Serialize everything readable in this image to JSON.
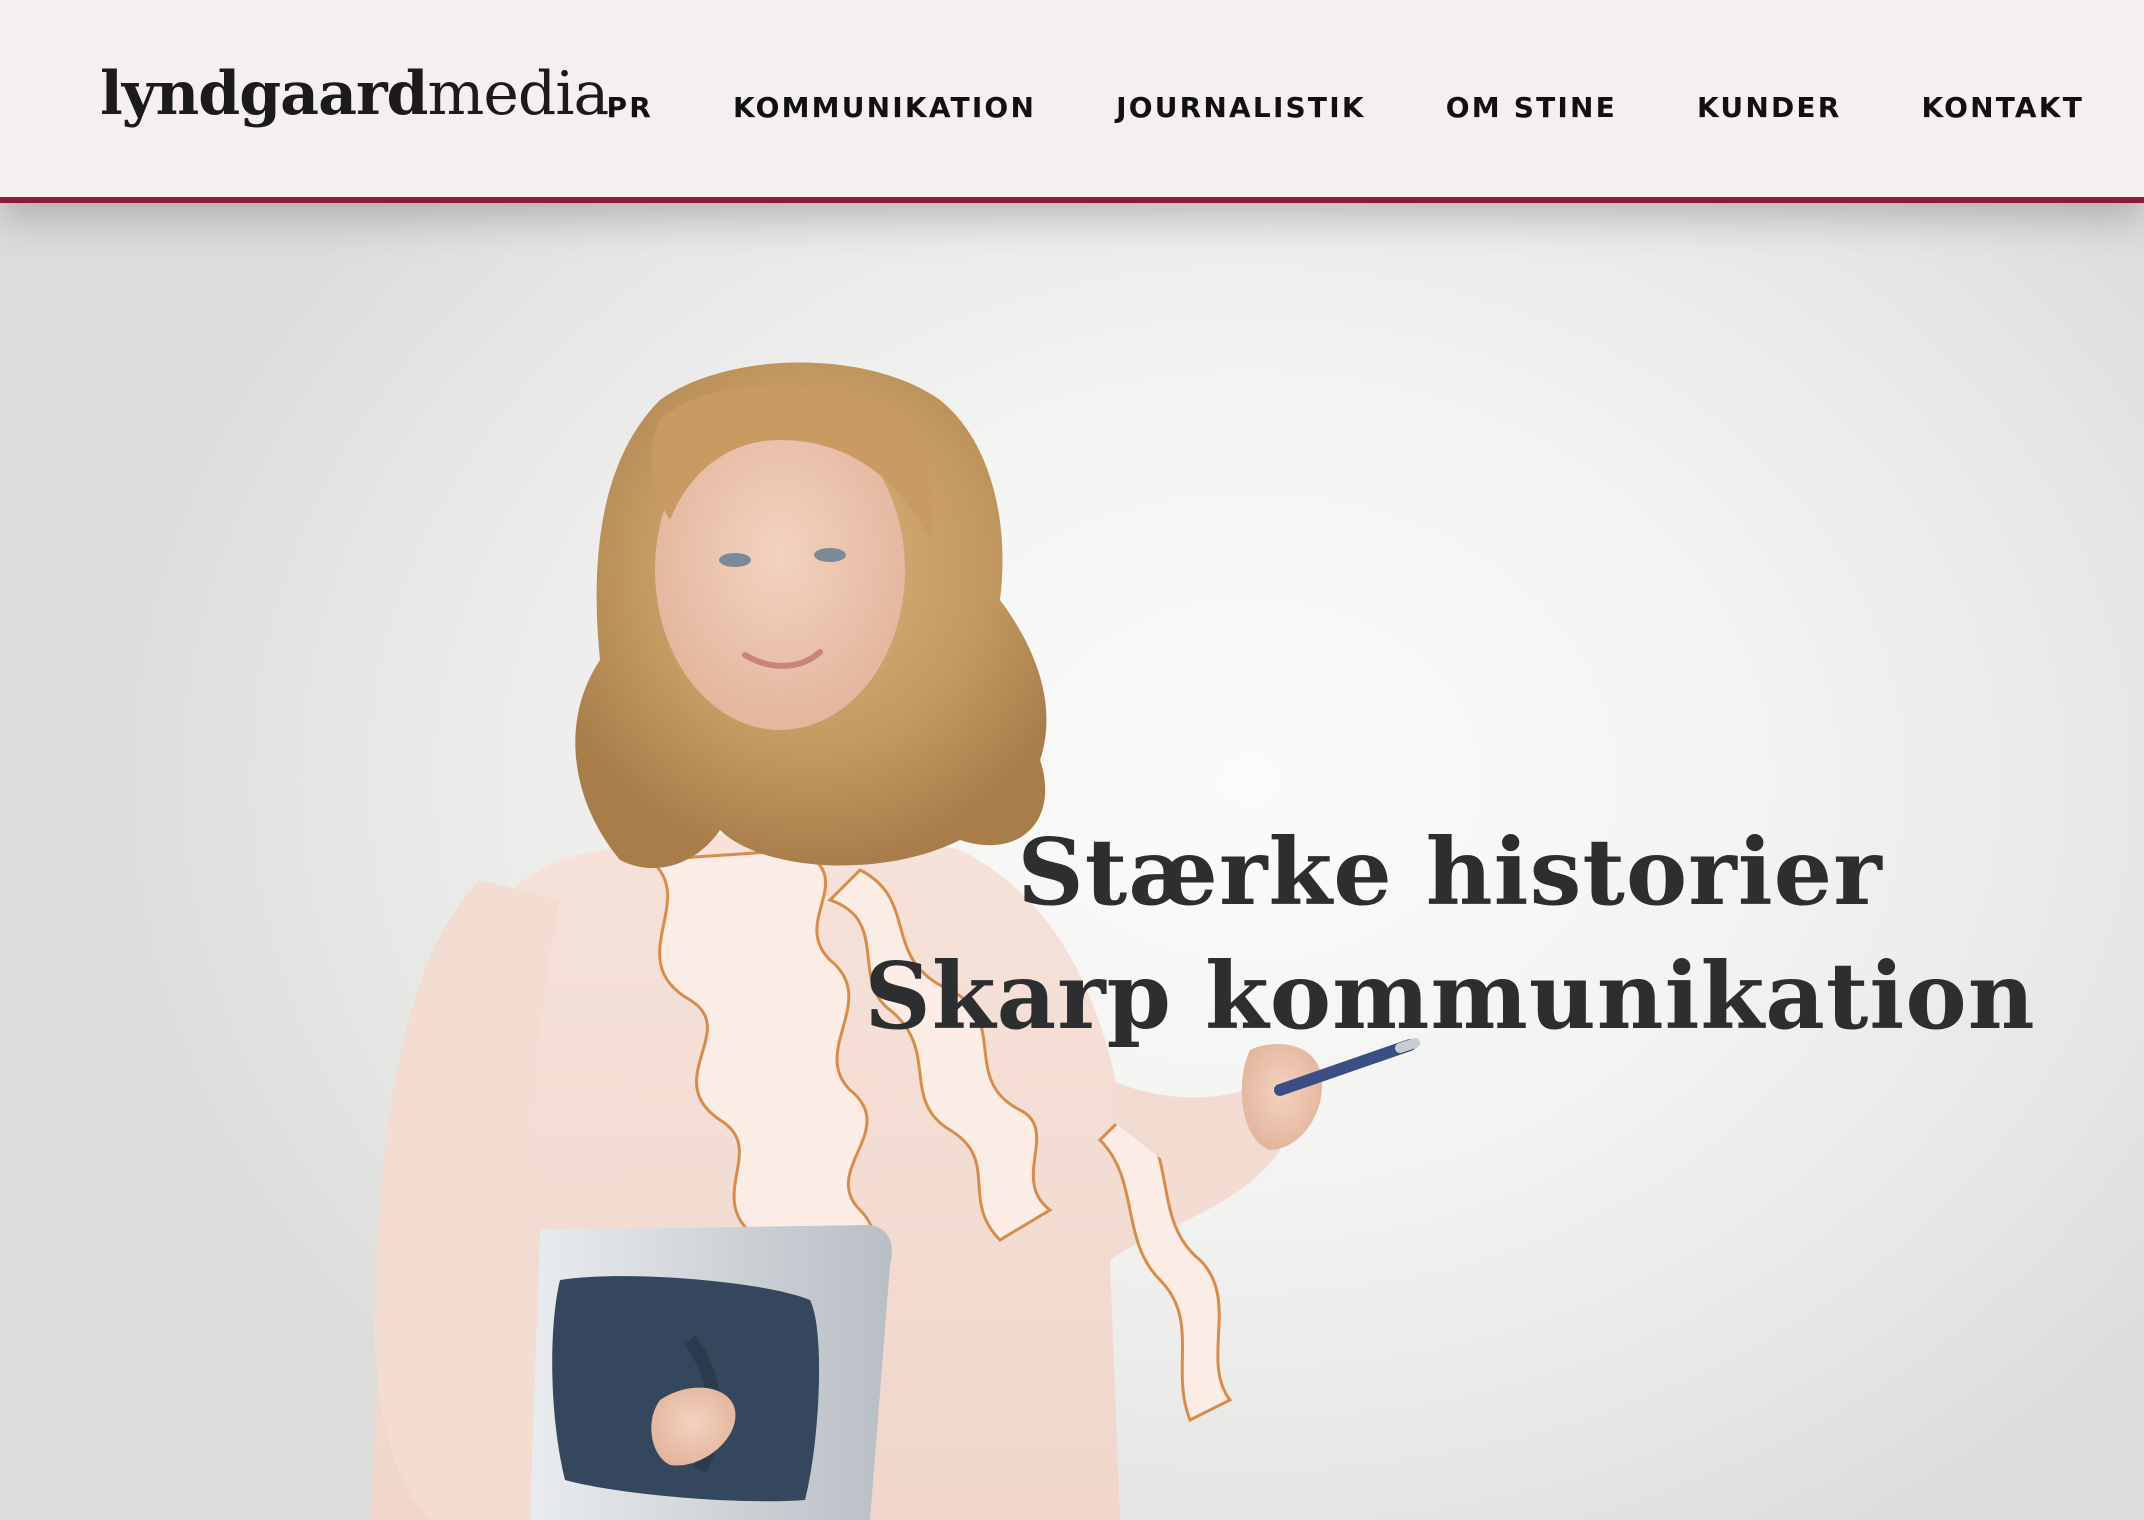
{
  "header": {
    "logo": {
      "bold": "lyndgaard",
      "light": "media"
    },
    "nav": [
      {
        "label": "PR"
      },
      {
        "label": "KOMMUNIKATION"
      },
      {
        "label": "JOURNALISTIK"
      },
      {
        "label": "OM STINE"
      },
      {
        "label": "KUNDER"
      },
      {
        "label": "KONTAKT"
      }
    ],
    "accent_color": "#8e1a3b",
    "background_color": "#f6efef"
  },
  "hero": {
    "headline_line1": "Stærke historier",
    "headline_line2": "Skarp kommunikation",
    "headline_color": "#2d2e2f",
    "photo": "portrait-of-woman-holding-pen-and-laptop"
  }
}
